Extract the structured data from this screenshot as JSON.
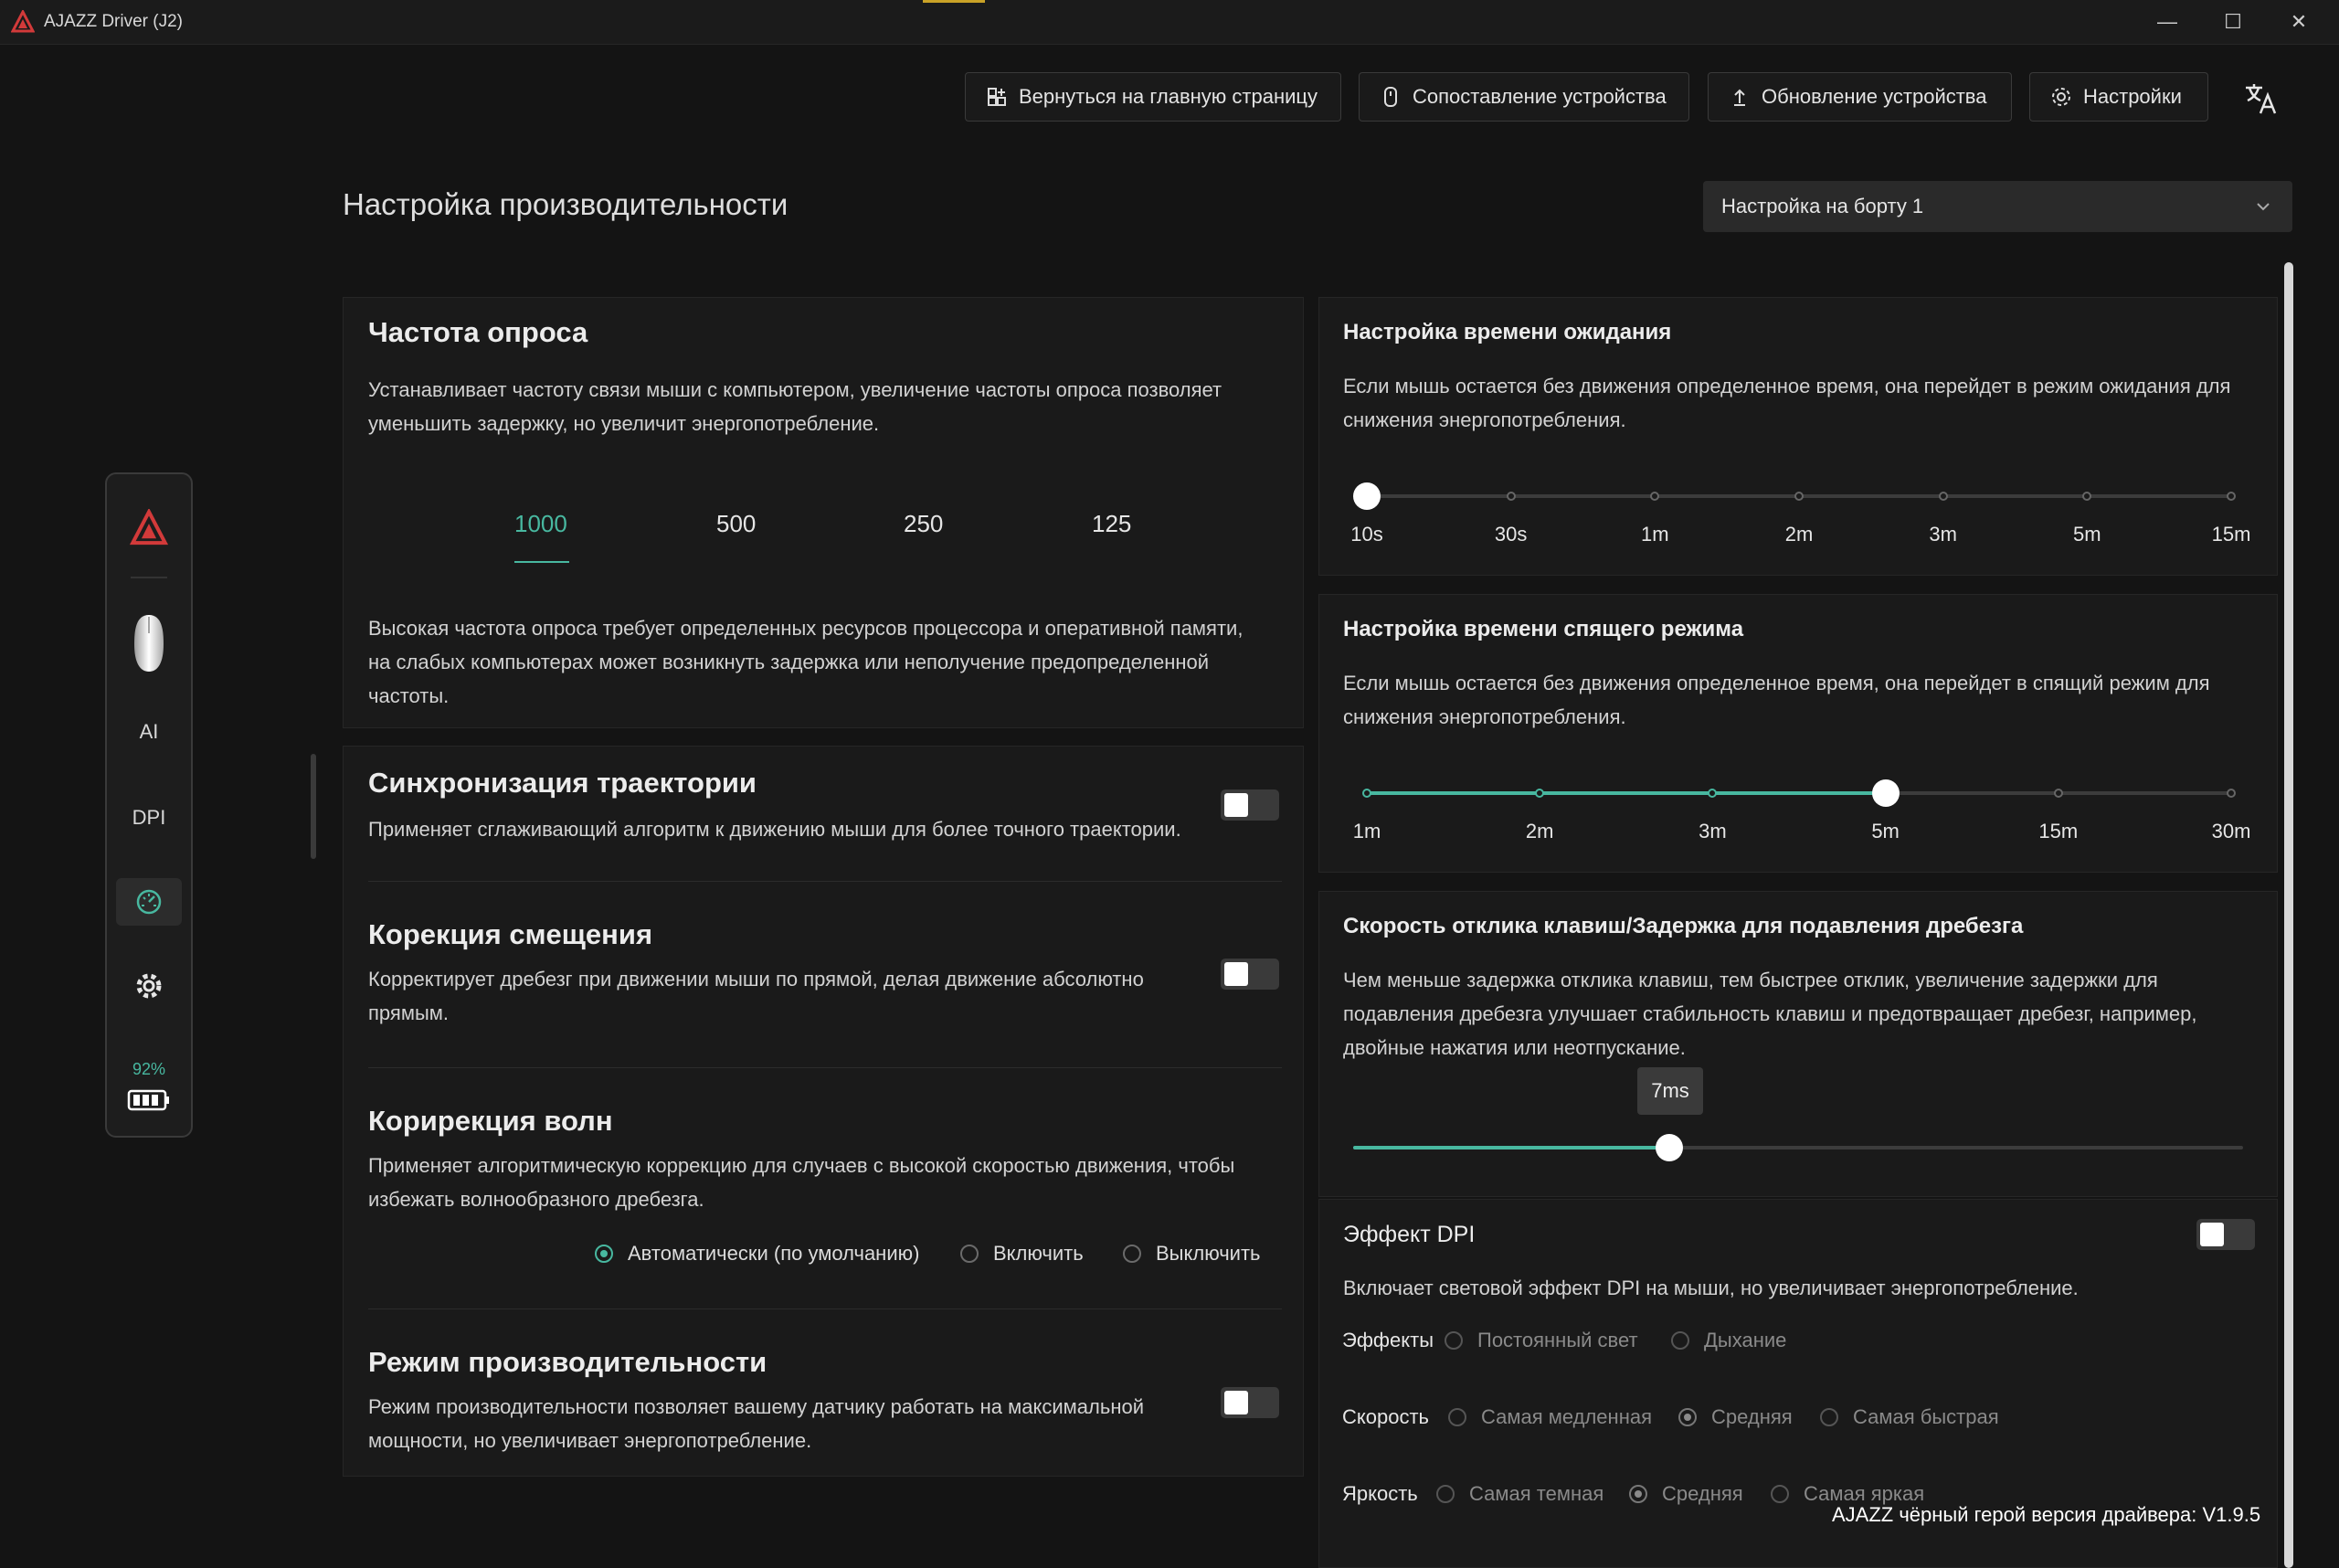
{
  "window": {
    "title": "AJAZZ Driver (J2)",
    "minimize": "—",
    "maximize": "☐",
    "close": "✕"
  },
  "header": {
    "home": "Вернуться на главную страницу",
    "pairing": "Сопоставление устройства",
    "update": "Обновление устройства",
    "settings": "Настройки"
  },
  "page": {
    "title": "Настройка производительности",
    "profile": "Настройка на борту 1"
  },
  "sidebar": {
    "ai": "AI",
    "dpi": "DPI",
    "battery": "92%"
  },
  "polling": {
    "title": "Частота опроса",
    "desc1": "Устанавливает частоту связи мыши с компьютером, увеличение частоты опроса позволяет",
    "desc2": "уменьшить задержку, но увеличит энергопотребление.",
    "rates": [
      "1000",
      "500",
      "250",
      "125"
    ],
    "selected": "1000",
    "note1": "Высокая частота опроса требует определенных ресурсов процессора и оперативной памяти,",
    "note2": "на слабых компьютерах может возникнуть задержка или неполучение предопределенной",
    "note3": "частоты."
  },
  "trajectory": {
    "title": "Синхронизация траектории",
    "desc": "Применяет сглаживающий алгоритм к движению мыши для более точного траектории."
  },
  "offset": {
    "title": "Корекция смещения",
    "desc1": "Корректирует дребезг при движении мыши по прямой, делая движение абсолютно",
    "desc2": "прямым."
  },
  "waves": {
    "title": "Корирекция волн",
    "desc1": "Применяет алгоритмическую коррекцию для случаев с высокой скоростью движения, чтобы",
    "desc2": "избежать волнообразного дребезга.",
    "options": [
      "Автоматически (по умолчанию)",
      "Включить",
      "Выключить"
    ],
    "selected": "Автоматически (по умолчанию)"
  },
  "performance": {
    "title": "Режим производительности",
    "desc1": "Режим производительности позволяет вашему датчику работать на максимальной",
    "desc2": "мощности, но увеличивает энергопотребление."
  },
  "standby": {
    "title": "Настройка времени ожидания",
    "desc1": "Если мышь остается без движения определенное время, она перейдет в режим ожидания для",
    "desc2": "снижения энергопотребления.",
    "labels": [
      "10s",
      "30s",
      "1m",
      "2m",
      "3m",
      "5m",
      "15m"
    ],
    "value_index": 0
  },
  "sleep": {
    "title": "Настройка времени спящего режима",
    "desc1": "Если мышь остается без движения определенное время, она перейдет в спящий режим для",
    "desc2": "снижения энергопотребления.",
    "labels": [
      "1m",
      "2m",
      "3m",
      "5m",
      "15m",
      "30m"
    ],
    "value_index": 3
  },
  "debounce": {
    "title": "Скорость отклика клавиш/Задержка для подавления дребезга",
    "desc1": "Чем меньше задержка отклика клавиш, тем быстрее отклик, увеличение задержки для",
    "desc2": "подавления дребезга улучшает стабильность клавиш и предотвращает дребезг, например,",
    "desc3": "двойные нажатия или неотпускание.",
    "value": "7ms",
    "fraction": 0.355
  },
  "dpi_effect": {
    "title": "Эффект DPI",
    "desc": "Включает световой эффект DPI на мыши, но увеличивает энергопотребление.",
    "effects_label": "Эффекты",
    "effects": [
      "Постоянный свет",
      "Дыхание"
    ],
    "speed_label": "Скорость",
    "speeds": [
      "Самая медленная",
      "Средняя",
      "Самая быстрая"
    ],
    "speed_selected": "Средняя",
    "brightness_label": "Яркость",
    "brightness": [
      "Самая темная",
      "Средняя",
      "Самая яркая"
    ],
    "brightness_selected": "Средняя"
  },
  "footer": {
    "version": "AJAZZ чёрный герой версия драйвера: V1.9.5"
  },
  "colors": {
    "accent": "#48b8a0",
    "background": "#141414",
    "panel": "#1a1a1a",
    "brand_red": "#d23a3a"
  }
}
